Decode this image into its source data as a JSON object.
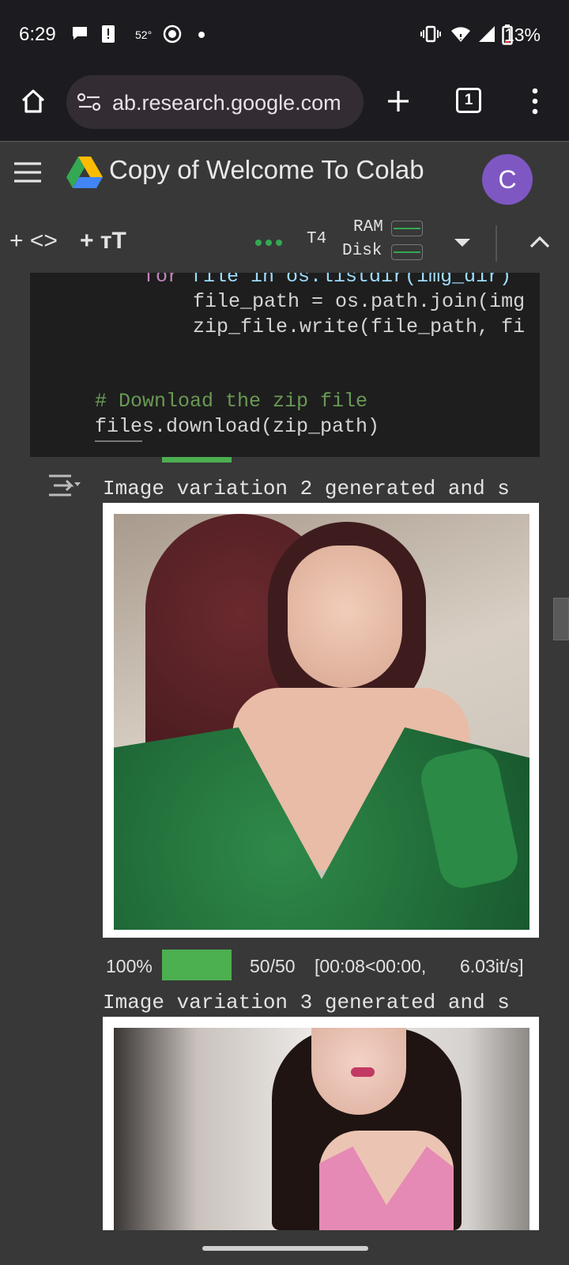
{
  "status_bar": {
    "time": "6:29",
    "temperature": "52°",
    "battery": "13%",
    "left_icons": [
      "chat-bubble-icon",
      "alert-icon",
      "thermometer-icon",
      "record-icon",
      "dot-icon"
    ],
    "right_icons": [
      "vibrate-icon",
      "wifi-icon",
      "signal-icon",
      "battery-icon"
    ]
  },
  "browser": {
    "url": "ab.research.google.com",
    "tab_count": "1",
    "icons": [
      "home-icon",
      "site-settings-icon",
      "new-tab-icon",
      "tabs-icon",
      "more-vert-icon"
    ]
  },
  "colab": {
    "title": "Copy of Welcome To Colab",
    "avatar_letter": "C",
    "icons": [
      "hamburger-menu-icon",
      "google-drive-icon"
    ]
  },
  "toolbar": {
    "add_code": "+ <>",
    "add_text": "+ тT",
    "runtime": "T4",
    "ram_label": "RAM",
    "disk_label": "Disk",
    "status_color": "#34a853"
  },
  "code": {
    "line1_kw": "for",
    "line1_rest": " file in os.listdir(img_dir)",
    "line2": "file_path = os.path.join(img",
    "line3": "zip_file.write(file_path, fi",
    "comment": "# Download the zip file",
    "line5": "files.download(zip_path)"
  },
  "output": {
    "variation2_text": "Image variation 2 generated and s",
    "progress_percent": "100%",
    "progress_fraction": 1.0,
    "progress_steps": "50/50",
    "progress_time": "[00:08<00:00,",
    "progress_rate": "6.03it/s]",
    "variation3_text": "Image variation 3 generated and s",
    "accent": "#4caf50"
  }
}
